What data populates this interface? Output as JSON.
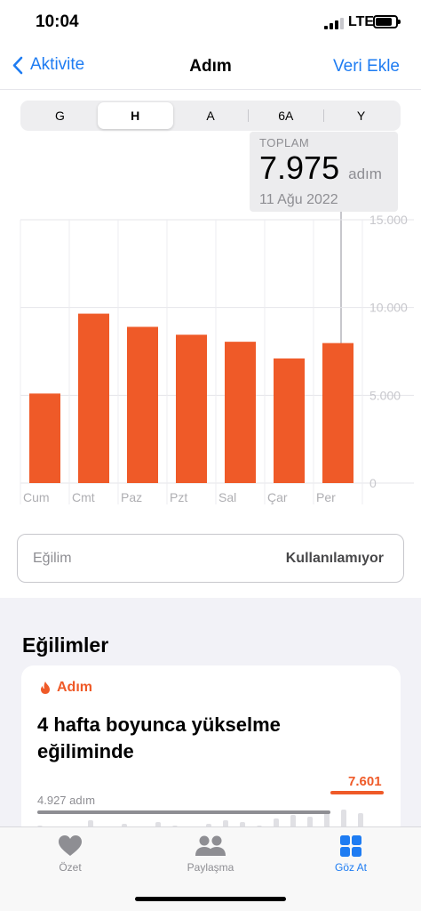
{
  "status": {
    "time": "10:04",
    "network": "LTE"
  },
  "nav": {
    "back_label": "Aktivite",
    "title": "Adım",
    "action_label": "Veri Ekle"
  },
  "segments": [
    "G",
    "H",
    "A",
    "6A",
    "Y"
  ],
  "selected_segment": "H",
  "tooltip": {
    "label": "TOPLAM",
    "value": "7.975",
    "unit": "adım",
    "date": "11 Ağu 2022"
  },
  "chart_data": {
    "type": "bar",
    "categories": [
      "Cum",
      "Cmt",
      "Paz",
      "Pzt",
      "Sal",
      "Çar",
      "Per"
    ],
    "values": [
      5100,
      9650,
      8900,
      8450,
      8050,
      7100,
      7975
    ],
    "ylim": [
      0,
      15000
    ],
    "yticks": [
      0,
      5000,
      10000,
      15000
    ],
    "ytick_labels": [
      "0",
      "5.000",
      "10.000",
      "15.000"
    ],
    "bar_color": "#ef5a28",
    "highlighted_category": "Per",
    "grid": true
  },
  "trend": {
    "label": "Eğilim",
    "value": "Kullanılamıyor"
  },
  "trends_section": {
    "title": "Eğilimler",
    "card": {
      "metric": "Adım",
      "text": "4 hafta boyunca yükselme eğiliminde",
      "min_label": "4.927 adım",
      "max_label": "7.601"
    }
  },
  "tabs": [
    {
      "label": "Özet",
      "icon": "heart-icon"
    },
    {
      "label": "Paylaşma",
      "icon": "people-icon"
    },
    {
      "label": "Göz At",
      "icon": "grid-icon"
    }
  ],
  "colors": {
    "accent": "#1e7cf2",
    "steps": "#ef5a28"
  }
}
